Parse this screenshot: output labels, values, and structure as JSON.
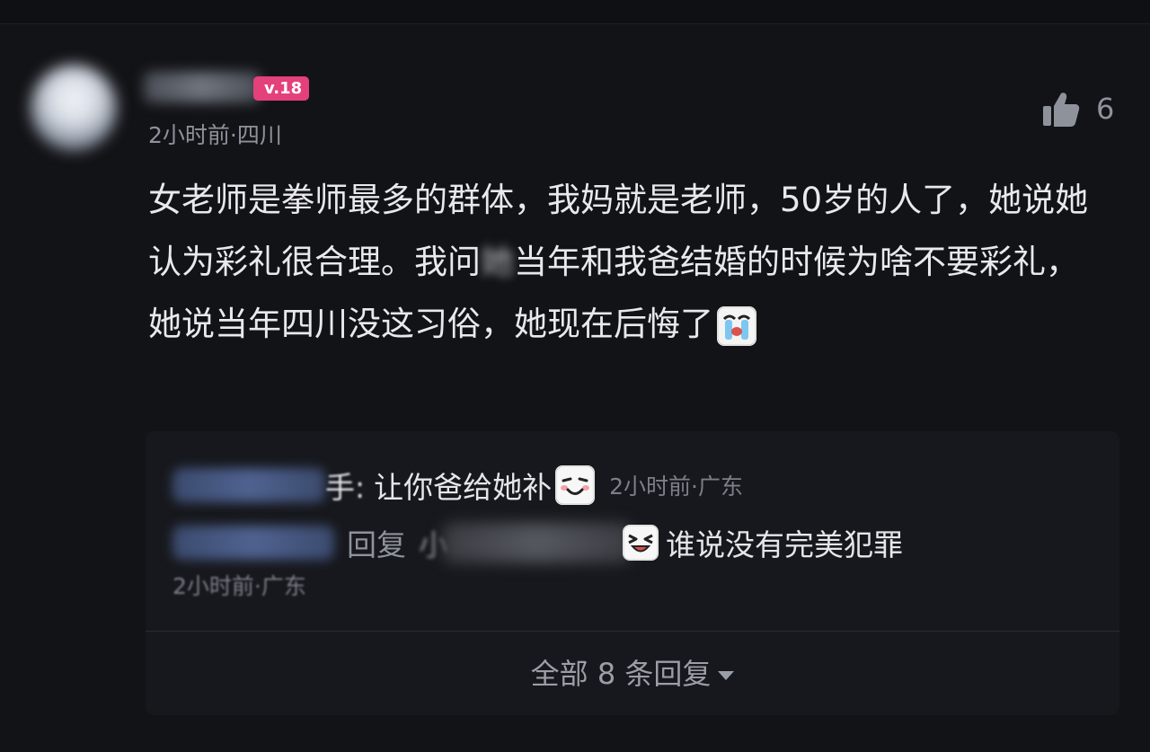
{
  "comment": {
    "level_badge": "v.18",
    "meta": "2小时前·四川",
    "like_count": "6",
    "text_part1": "女老师是拳师最多的群体，我妈就是老师，50岁的人了，她说她认为彩礼很合理。我问",
    "text_hidden_char": "她",
    "text_part2": "当年和我爸结婚的时候为啥不要彩礼，她说当年四川没这习俗，她现在后悔了",
    "trailing_emoji": "crying-emoji"
  },
  "replies": [
    {
      "name_suffix": "手:",
      "text": "让你爸给她补",
      "emoji": "smirk-emoji",
      "time": "2小时前·广东"
    },
    {
      "verb": "回复",
      "target_prefix": "小",
      "emoji": "laughing-emoji",
      "text": "谁说没有完美犯罪",
      "time": "2小时前·广东"
    }
  ],
  "show_all": "全部 8 条回复",
  "colors": {
    "background": "#121317",
    "badge": "#e4407a",
    "reply_panel": "#17181d",
    "text_primary": "#e9e9ec",
    "text_secondary": "#8e929b"
  }
}
